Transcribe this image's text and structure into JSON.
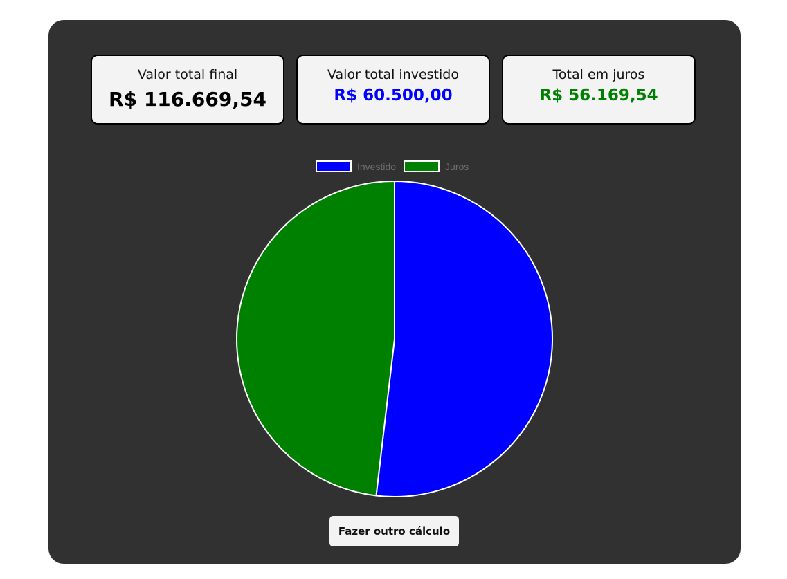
{
  "cards": {
    "final": {
      "label": "Valor total final",
      "value": "R$ 116.669,54",
      "color": "#000000"
    },
    "investido": {
      "label": "Valor total investido",
      "value": "R$ 60.500,00",
      "color": "#0000ff"
    },
    "juros": {
      "label": "Total em juros",
      "value": "R$ 56.169,54",
      "color": "#008000"
    }
  },
  "chart_data": {
    "type": "pie",
    "title": "",
    "legend_position": "top",
    "categories": [
      "Investido",
      "Juros"
    ],
    "values": [
      60500.0,
      56169.54
    ],
    "colors": [
      "#0000ff",
      "#008000"
    ],
    "border_color": "#ffffff"
  },
  "actions": {
    "recalc_label": "Fazer outro cálculo"
  }
}
